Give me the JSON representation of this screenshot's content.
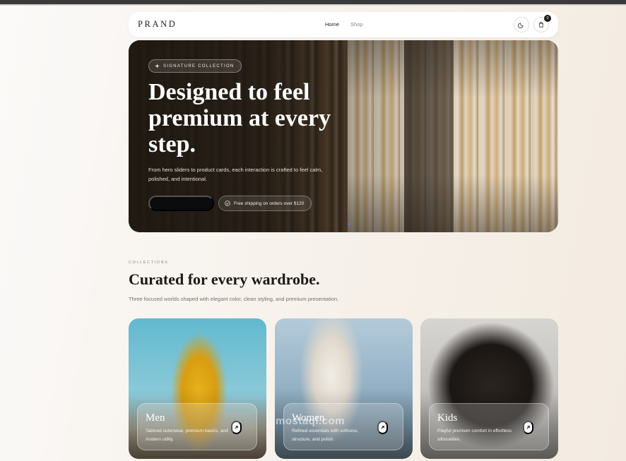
{
  "nav": {
    "brand": "PRAND",
    "links": [
      {
        "label": "Home",
        "active": true
      },
      {
        "label": "Shop",
        "active": false
      }
    ],
    "theme_icon": "moon-icon",
    "cart_icon": "bag-icon",
    "cart_count": "0"
  },
  "hero": {
    "chip": "SIGNATURE COLLECTION",
    "chip_icon": "sparkle-icon",
    "title": "Designed to feel premium at every step.",
    "subtitle": "From hero sliders to product cards, each interaction is crafted to feel calm, polished, and intentional.",
    "cta_label": "",
    "shipping": "Free shipping on orders over $120",
    "shipping_icon": "check-circle-icon",
    "slide_indicator_color": "#3b82f6"
  },
  "collections": {
    "eyebrow": "COLLECTIONS",
    "title": "Curated for every wardrobe.",
    "subtitle": "Three focused worlds shaped with elegant color, clean styling, and premium presentation.",
    "cards": [
      {
        "name": "Men",
        "desc": "Tailored outerwear, premium basics, and modern utility.",
        "icon": "arrow-up-right-icon"
      },
      {
        "name": "Women",
        "desc": "Refined essentials with softness, structure, and polish.",
        "icon": "arrow-up-right-icon"
      },
      {
        "name": "Kids",
        "desc": "Playful premium comfort in effortless silhouettes.",
        "icon": "arrow-up-right-icon"
      }
    ]
  },
  "watermark": "mostaql.com",
  "colors": {
    "accent": "#0c0c0c",
    "background": "#f7f2ec"
  }
}
